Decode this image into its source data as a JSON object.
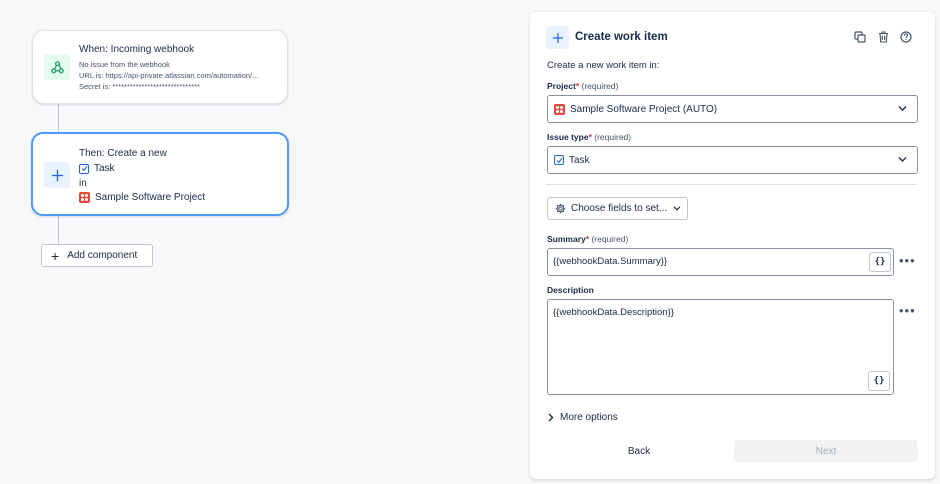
{
  "canvas": {
    "trigger": {
      "title": "When: Incoming webhook",
      "line1": "No issue from the webhook",
      "line2": "URL is: https://api-private.atlassian.com/automation/...",
      "line3": "Secret is: ******************************",
      "icon": "webhook-icon"
    },
    "action": {
      "title": "Then: Create a new",
      "type": "Task",
      "connector": "in",
      "project": "Sample Software Project",
      "icon": "plus-icon"
    },
    "add_component": "Add component"
  },
  "panel": {
    "title": "Create work item",
    "intro": "Create a new work item in:",
    "project": {
      "label": "Project",
      "required_mark": "*",
      "required_note": "(required)",
      "value": "Sample Software Project (AUTO)"
    },
    "issue_type": {
      "label": "Issue type",
      "required_mark": "*",
      "required_note": "(required)",
      "value": "Task"
    },
    "choose_fields": "Choose fields to set...",
    "summary": {
      "label": "Summary",
      "required_mark": "*",
      "required_note": "(required)",
      "value": "{{webhookData.Summary}}"
    },
    "description": {
      "label": "Description",
      "value": "{{webhookData.Description}}"
    },
    "brace_label": "{}",
    "more_options": "More options",
    "back": "Back",
    "next": "Next"
  },
  "colors": {
    "accent": "#4c9aff",
    "required": "#c9372c",
    "project_icon": "#e2483d",
    "task_icon": "#1868db"
  }
}
